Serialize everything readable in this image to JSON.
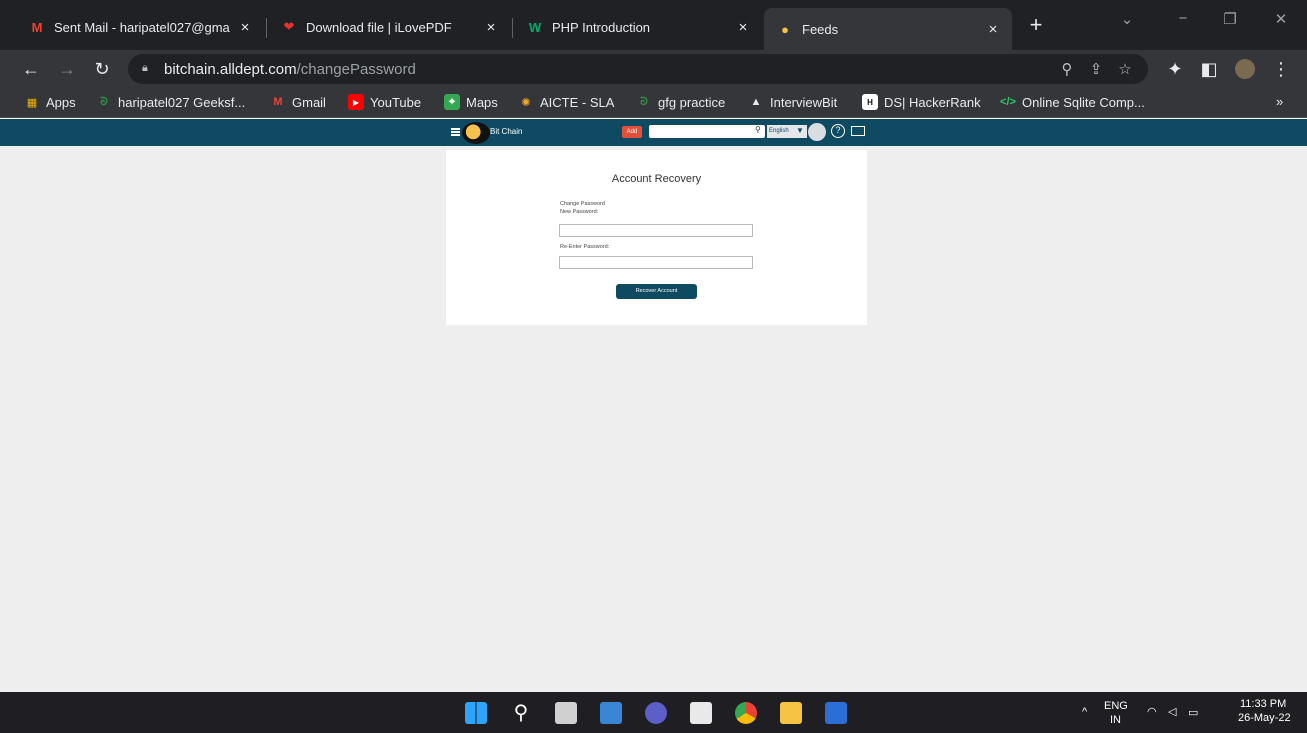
{
  "browser": {
    "tabs": [
      {
        "title": "Sent Mail - haripatel027@gma",
        "icon": "gmail-icon",
        "active": false
      },
      {
        "title": "Download file | iLovePDF",
        "icon": "ilovepdf-icon",
        "active": false
      },
      {
        "title": "PHP Introduction",
        "icon": "w3schools-icon",
        "active": false
      },
      {
        "title": "Feeds",
        "icon": "bitchain-icon",
        "active": true
      }
    ],
    "url_host": "bitchain.alldept.com",
    "url_path": "/changePassword",
    "bookmarks": [
      {
        "label": "Apps",
        "color": "#f4b400"
      },
      {
        "label": "haripatel027 Geeksf...",
        "color": "#2f8d46"
      },
      {
        "label": "Gmail",
        "color": "#ea4335"
      },
      {
        "label": "YouTube",
        "color": "#ff0000"
      },
      {
        "label": "Maps",
        "color": "#34a853"
      },
      {
        "label": "AICTE - SLA",
        "color": "#f9a825"
      },
      {
        "label": "gfg practice",
        "color": "#2f8d46"
      },
      {
        "label": "InterviewBit",
        "color": "#e8eaed"
      },
      {
        "label": "DS| HackerRank",
        "color": "#ffffff"
      },
      {
        "label": "Online Sqlite Comp...",
        "color": "#2ecc71"
      }
    ],
    "bookmarks_more": "»"
  },
  "site": {
    "logo_text": "Bit Chain",
    "add_label": "Add",
    "language": "English",
    "help_glyph": "?",
    "accent": "#0f4a63"
  },
  "recovery": {
    "title": "Account Recovery",
    "section_label": "Change Password",
    "new_password_label": "New Password:",
    "reenter_label": "Re-Enter Password:",
    "button_label": "Recover Account"
  },
  "taskbar": {
    "language": "ENG",
    "region": "IN",
    "time": "11:33 PM",
    "date": "26-May-22"
  }
}
